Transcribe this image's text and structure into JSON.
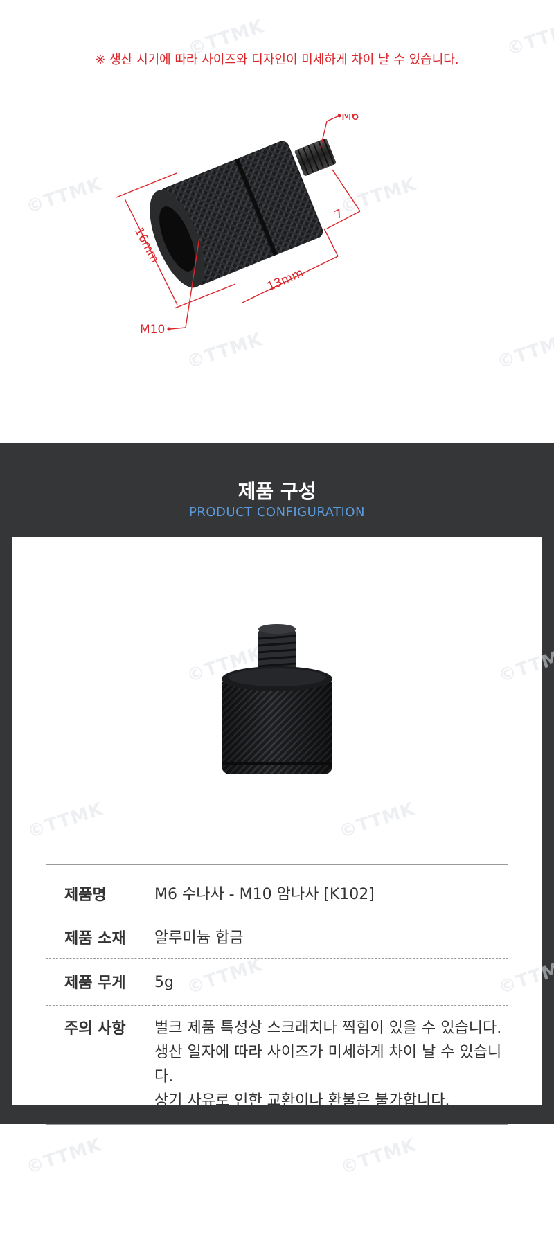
{
  "notice": "※ 생산 시기에 따라 사이즈와 디자인이 미세하게 차이 날 수 있습니다.",
  "watermark": "©TTMK",
  "diagram": {
    "label_m6": "M6",
    "label_m10": "M10",
    "label_16mm": "16mm",
    "label_13mm": "13mm",
    "label_7": "7",
    "dimension_color": "#d9262b"
  },
  "section": {
    "title": "제품 구성",
    "subtitle": "PRODUCT CONFIGURATION"
  },
  "specs": [
    {
      "key": "제품명",
      "lines": [
        "M6 수나사 - M10 암나사 [K102]"
      ]
    },
    {
      "key": "제품 소재",
      "lines": [
        "알루미늄 합금"
      ]
    },
    {
      "key": "제품 무게",
      "lines": [
        "5g"
      ]
    },
    {
      "key": "주의 사항",
      "lines": [
        "벌크 제품 특성상 스크래치나 찍힘이 있을 수 있습니다.",
        "생산 일자에 따라 사이즈가 미세하게 차이 날 수 있습니다.",
        "상기 사유로 인한 교환이나 환불은 불가합니다."
      ]
    }
  ]
}
